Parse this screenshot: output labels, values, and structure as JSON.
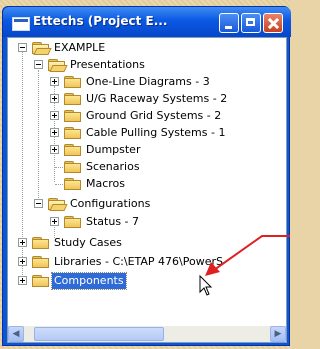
{
  "window": {
    "title": "Ettechs (Project E...",
    "buttons": {
      "minimize": "minimize",
      "maximize": "maximize",
      "close": "close"
    }
  },
  "tree": {
    "root": "EXAMPLE",
    "presentations": {
      "label": "Presentations",
      "items": [
        "One-Line Diagrams - 3",
        "U/G Raceway Systems - 2",
        "Ground Grid Systems - 2",
        "Cable Pulling Systems - 1",
        "Dumpster",
        "Scenarios",
        "Macros"
      ]
    },
    "configurations": {
      "label": "Configurations",
      "items": [
        "Status - 7"
      ]
    },
    "study_cases": "Study Cases",
    "libraries": "Libraries - C:\\ETAP 476\\PowerS",
    "components": "Components"
  },
  "icons": {
    "app": "app-window-icon",
    "folder": "folder-icon",
    "open_folder": "open-folder-icon",
    "cursor": "mouse-pointer-icon"
  },
  "colors": {
    "selection": "#2f6bd6",
    "titlebar": "#0a58e3",
    "arrow": "#e02020"
  }
}
